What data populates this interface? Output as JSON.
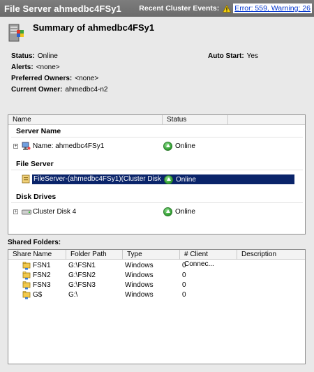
{
  "titlebar": {
    "title": "File Server ahmedbc4FSy1",
    "events_label": "Recent Cluster Events:",
    "events_link": "Error: 559, Warning: 26"
  },
  "summary": {
    "title": "Summary of ahmedbc4FSy1",
    "status_label": "Status:",
    "status_value": "Online",
    "auto_start_label": "Auto Start:",
    "auto_start_value": "Yes",
    "alerts_label": "Alerts:",
    "alerts_value": "<none>",
    "preferred_owners_label": "Preferred Owners:",
    "preferred_owners_value": "<none>",
    "current_owner_label": "Current Owner:",
    "current_owner_value": "ahmedbc4-n2"
  },
  "resources": {
    "columns": [
      "Name",
      "Status"
    ],
    "groups": [
      {
        "title": "Server Name",
        "items": [
          {
            "name": "Name: ahmedbc4FSy1",
            "status": "Online",
            "icon": "network-name-icon"
          }
        ]
      },
      {
        "title": "File Server",
        "items": [
          {
            "name": "FileServer-(ahmedbc4FSy1)(Cluster Disk 4)",
            "status": "Online",
            "icon": "file-server-icon"
          }
        ]
      },
      {
        "title": "Disk Drives",
        "items": [
          {
            "name": "Cluster Disk 4",
            "status": "Online",
            "icon": "disk-drive-icon"
          }
        ]
      }
    ]
  },
  "shared_folders": {
    "label": "Shared Folders:",
    "columns": [
      "Share Name",
      "Folder Path",
      "Type",
      "# Client Connec...",
      "Description"
    ],
    "rows": [
      {
        "name": "FSN1",
        "path": "G:\\FSN1",
        "type": "Windows",
        "clients": "0",
        "description": ""
      },
      {
        "name": "FSN2",
        "path": "G:\\FSN2",
        "type": "Windows",
        "clients": "0",
        "description": ""
      },
      {
        "name": "FSN3",
        "path": "G:\\FSN3",
        "type": "Windows",
        "clients": "0",
        "description": ""
      },
      {
        "name": "G$",
        "path": "G:\\",
        "type": "Windows",
        "clients": "0",
        "description": ""
      }
    ]
  },
  "colors": {
    "titlebar": "#737373",
    "selection": "#0a246a",
    "online": "#2e9b2e",
    "link": "#0033cc"
  }
}
